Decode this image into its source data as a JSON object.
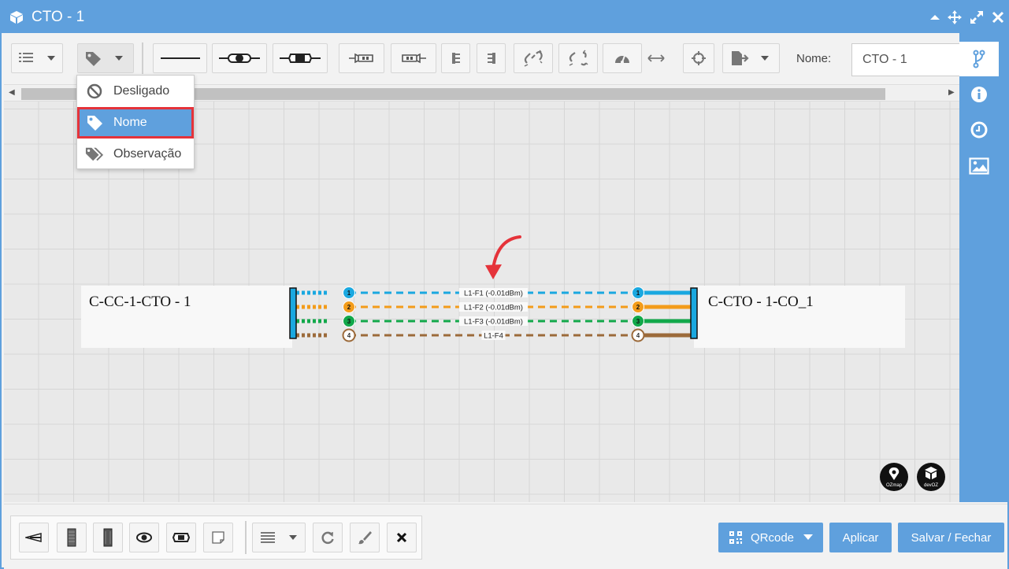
{
  "window": {
    "title": "CTO - 1"
  },
  "toolbar": {
    "nome_label": "Nome:",
    "nome_value": "CTO - 1"
  },
  "label_menu": {
    "items": [
      {
        "label": "Desligado",
        "icon": "ban-icon"
      },
      {
        "label": "Nome",
        "icon": "tag-icon",
        "selected": true
      },
      {
        "label": "Observação",
        "icon": "tags-icon"
      }
    ]
  },
  "diagram": {
    "left_cable": "C-CC-1-CTO - 1",
    "right_cable": "C-CTO - 1-CO_1",
    "fibers": [
      {
        "num": "1",
        "color": "#1aa8e0",
        "label": "L1-F1 (-0.01dBm)"
      },
      {
        "num": "2",
        "color": "#f39c1a",
        "label": "L1-F2 (-0.01dBm)"
      },
      {
        "num": "3",
        "color": "#12a84a",
        "label": "L1-F3 (-0.01dBm)"
      },
      {
        "num": "4",
        "color": "#9c6a3a",
        "label": "L1-F4"
      }
    ],
    "logo_left": "OZmap",
    "logo_right": "devOZ"
  },
  "footer": {
    "qrcode_label": "QRcode",
    "apply_label": "Aplicar",
    "save_close_label": "Salvar / Fechar"
  },
  "colors": {
    "accent": "#5fa0dd",
    "highlight": "#e5333a"
  }
}
